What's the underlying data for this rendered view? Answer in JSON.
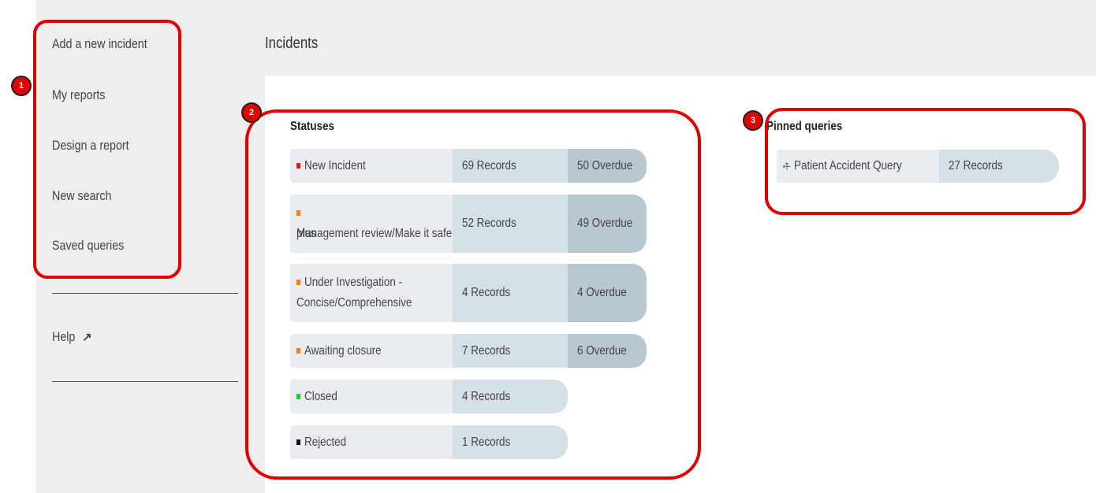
{
  "sidebar": {
    "items": [
      {
        "label": "Add a new incident"
      },
      {
        "label": "My reports"
      },
      {
        "label": "Design a report"
      },
      {
        "label": "New search"
      },
      {
        "label": "Saved queries"
      }
    ],
    "help_label": "Help",
    "help_icon": "external-link-icon"
  },
  "header": {
    "title": "Incidents"
  },
  "statuses": {
    "title": "Statuses",
    "rows": [
      {
        "name": "New Incident",
        "records": "69 Records",
        "overdue": "50 Overdue",
        "color": "#e01818"
      },
      {
        "name_line1": "Management review/Make it safe",
        "name_line2": "plus",
        "records": "52 Records",
        "overdue": "49 Overdue",
        "color": "#f07d1a"
      },
      {
        "name_line1": "Under Investigation -",
        "name_line2": "Concise/Comprehensive",
        "records": "4 Records",
        "overdue": "4 Overdue",
        "color": "#f07d1a"
      },
      {
        "name": "Awaiting closure",
        "records": "7 Records",
        "overdue": "6 Overdue",
        "color": "#f07d1a"
      },
      {
        "name": "Closed",
        "records": "4 Records",
        "color": "#22cc22"
      },
      {
        "name": "Rejected",
        "records": "1 Records",
        "color": "#111111"
      }
    ]
  },
  "pinned": {
    "title": "Pinned queries",
    "query": {
      "name": "Patient Accident Query",
      "records": "27 Records",
      "icon": "key-icon"
    }
  },
  "annotations": {
    "labels": [
      "1",
      "2",
      "3"
    ],
    "color": "#e00000"
  }
}
